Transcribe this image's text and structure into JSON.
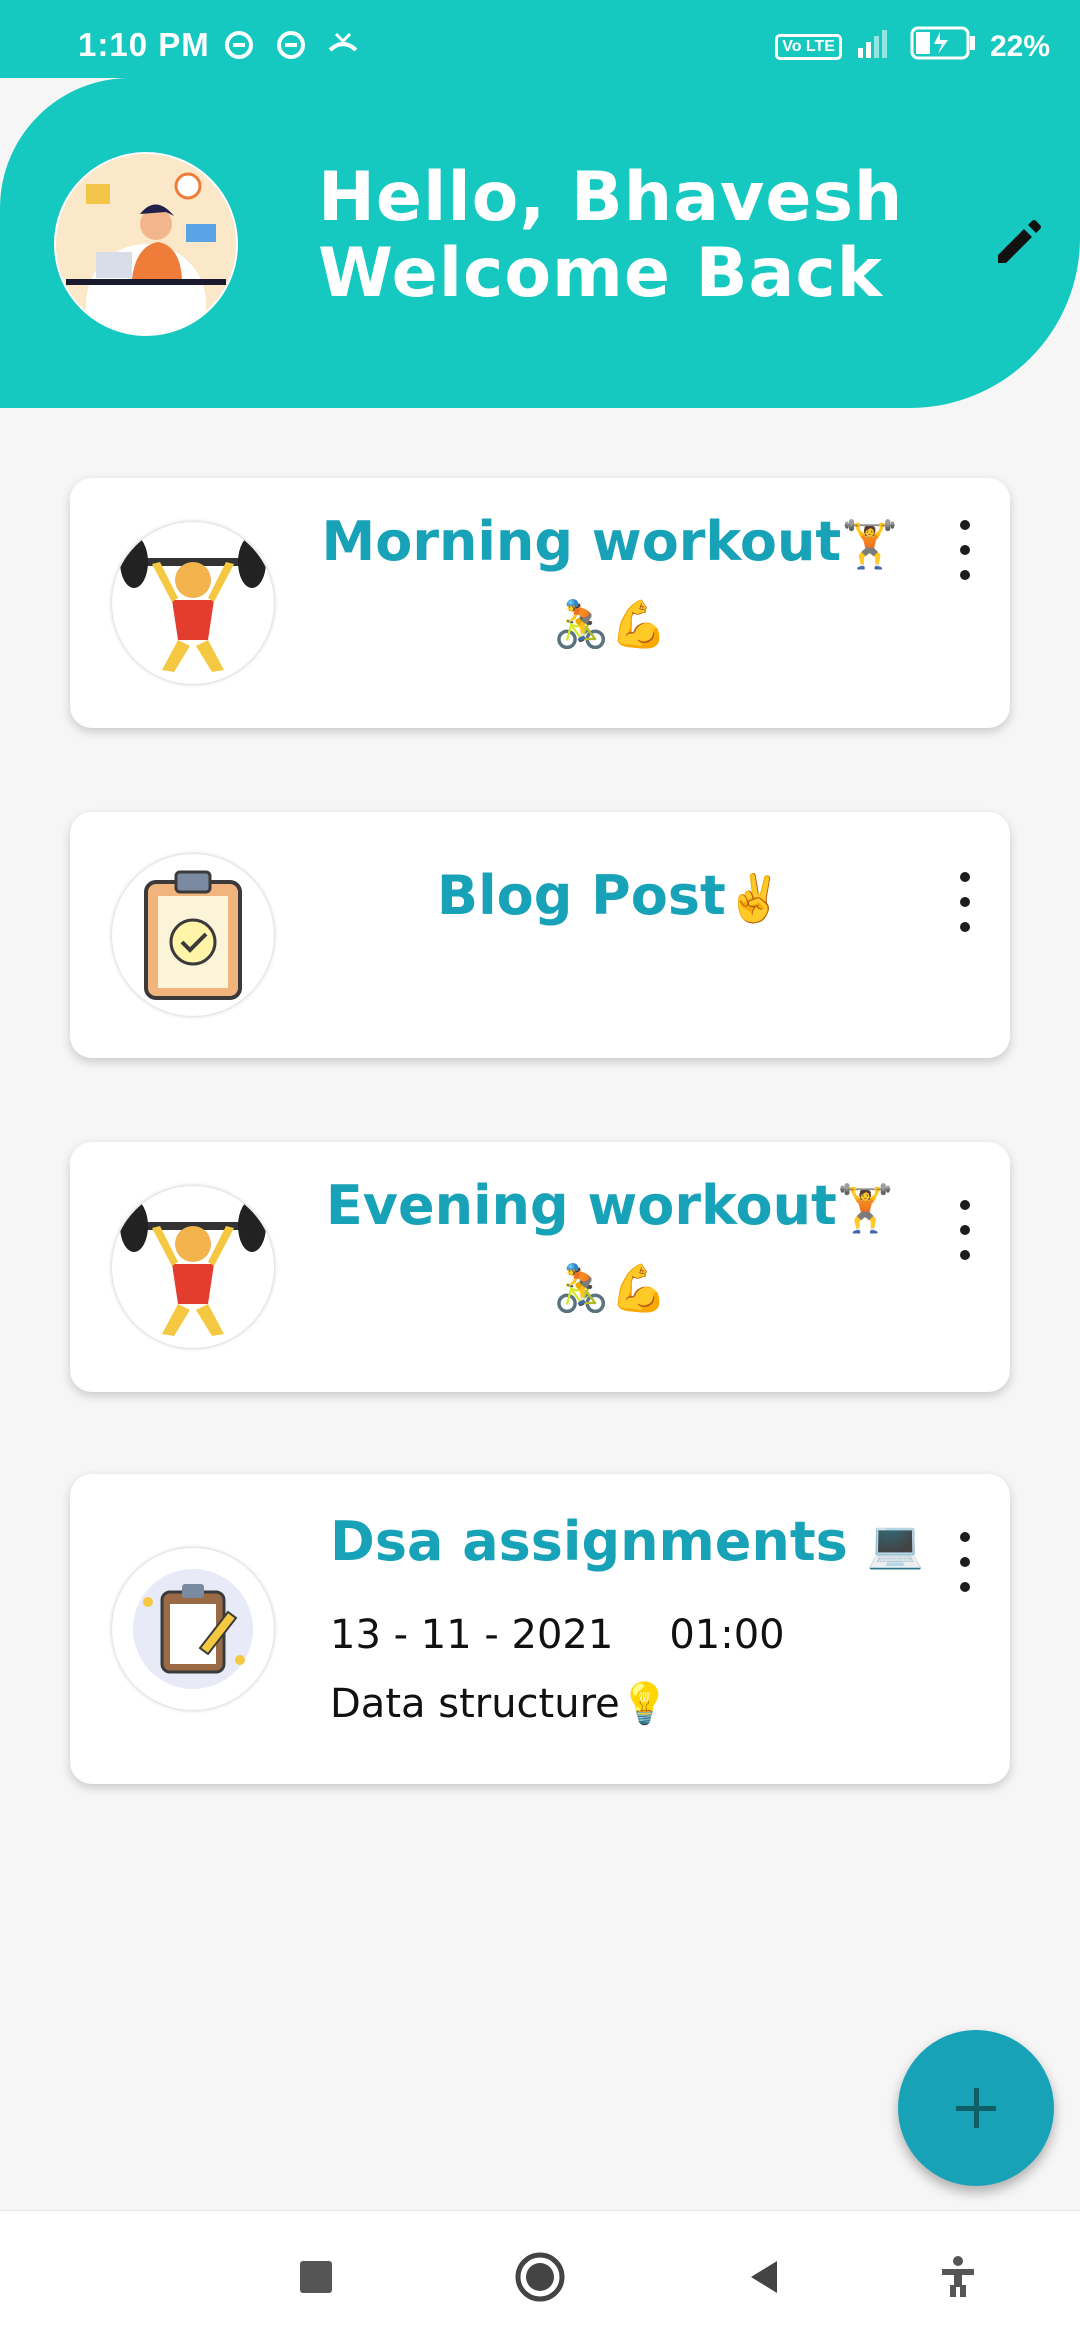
{
  "status_bar": {
    "time": "1:10 PM",
    "battery": "22%",
    "network_label": "Vo LTE"
  },
  "header": {
    "greeting_line1": "Hello, Bhavesh",
    "greeting_line2": "Welcome Back",
    "edit_icon": "pencil-icon",
    "accent_color": "#15c9c1"
  },
  "cards": [
    {
      "title": "Morning workout",
      "title_emoji": "🏋️",
      "extra_emojis": "🚴💪",
      "avatar_icon": "weightlifter-icon"
    },
    {
      "title": "Blog Post",
      "title_emoji": "✌️",
      "avatar_icon": "clipboard-check-icon"
    },
    {
      "title": "Evening workout",
      "title_emoji": "🏋️",
      "extra_emojis": "🚴💪",
      "avatar_icon": "weightlifter-icon"
    },
    {
      "title": "Dsa assignments",
      "title_emoji": "💻",
      "date": "13 - 11 - 2021",
      "time": "01:00",
      "description": "Data structure",
      "description_emoji": "💡",
      "avatar_icon": "clipboard-pencil-icon"
    }
  ],
  "fab": {
    "icon": "plus-icon",
    "color": "#18a2b8"
  },
  "nav": {
    "items": [
      "recents-square-icon",
      "home-circle-icon",
      "back-triangle-icon",
      "accessibility-icon"
    ]
  }
}
